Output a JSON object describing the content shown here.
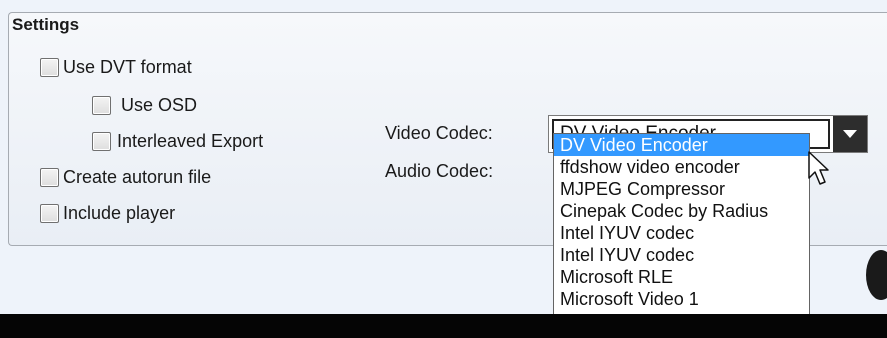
{
  "settings": {
    "title": "Settings",
    "use_dvt_format": "Use DVT format",
    "use_osd": "Use OSD",
    "interleaved_export": "Interleaved Export",
    "create_autorun": "Create autorun file",
    "include_player": "Include player"
  },
  "labels": {
    "video_codec": "Video Codec:",
    "audio_codec": "Audio Codec:"
  },
  "video_codec": {
    "selected": "DV Video Encoder"
  },
  "dropdown": {
    "options": [
      "DV Video Encoder",
      "ffdshow video encoder",
      "MJPEG Compressor",
      "Cinepak Codec by Radius",
      "Intel IYUV codec",
      "Intel IYUV codec",
      "Microsoft RLE",
      "Microsoft Video 1"
    ],
    "highlighted_index": 0
  },
  "colors": {
    "highlight": "#3399ff",
    "panel_border": "#a6abb2",
    "bottom_bar": "#050505"
  },
  "icons": {
    "dropdown_arrow": "chevron-down-icon",
    "cursor": "mouse-cursor-icon"
  }
}
